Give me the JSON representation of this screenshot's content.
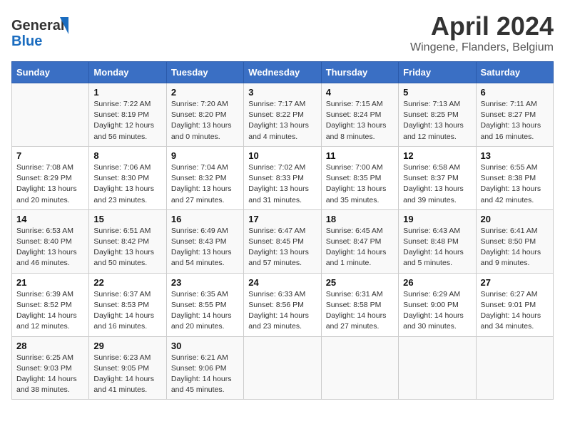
{
  "header": {
    "logo_line1": "General",
    "logo_line2": "Blue",
    "month_title": "April 2024",
    "location": "Wingene, Flanders, Belgium"
  },
  "days_of_week": [
    "Sunday",
    "Monday",
    "Tuesday",
    "Wednesday",
    "Thursday",
    "Friday",
    "Saturday"
  ],
  "weeks": [
    [
      {
        "num": "",
        "sunrise": "",
        "sunset": "",
        "daylight": ""
      },
      {
        "num": "1",
        "sunrise": "7:22 AM",
        "sunset": "8:19 PM",
        "daylight": "12 hours and 56 minutes."
      },
      {
        "num": "2",
        "sunrise": "7:20 AM",
        "sunset": "8:20 PM",
        "daylight": "13 hours and 0 minutes."
      },
      {
        "num": "3",
        "sunrise": "7:17 AM",
        "sunset": "8:22 PM",
        "daylight": "13 hours and 4 minutes."
      },
      {
        "num": "4",
        "sunrise": "7:15 AM",
        "sunset": "8:24 PM",
        "daylight": "13 hours and 8 minutes."
      },
      {
        "num": "5",
        "sunrise": "7:13 AM",
        "sunset": "8:25 PM",
        "daylight": "13 hours and 12 minutes."
      },
      {
        "num": "6",
        "sunrise": "7:11 AM",
        "sunset": "8:27 PM",
        "daylight": "13 hours and 16 minutes."
      }
    ],
    [
      {
        "num": "7",
        "sunrise": "7:08 AM",
        "sunset": "8:29 PM",
        "daylight": "13 hours and 20 minutes."
      },
      {
        "num": "8",
        "sunrise": "7:06 AM",
        "sunset": "8:30 PM",
        "daylight": "13 hours and 23 minutes."
      },
      {
        "num": "9",
        "sunrise": "7:04 AM",
        "sunset": "8:32 PM",
        "daylight": "13 hours and 27 minutes."
      },
      {
        "num": "10",
        "sunrise": "7:02 AM",
        "sunset": "8:33 PM",
        "daylight": "13 hours and 31 minutes."
      },
      {
        "num": "11",
        "sunrise": "7:00 AM",
        "sunset": "8:35 PM",
        "daylight": "13 hours and 35 minutes."
      },
      {
        "num": "12",
        "sunrise": "6:58 AM",
        "sunset": "8:37 PM",
        "daylight": "13 hours and 39 minutes."
      },
      {
        "num": "13",
        "sunrise": "6:55 AM",
        "sunset": "8:38 PM",
        "daylight": "13 hours and 42 minutes."
      }
    ],
    [
      {
        "num": "14",
        "sunrise": "6:53 AM",
        "sunset": "8:40 PM",
        "daylight": "13 hours and 46 minutes."
      },
      {
        "num": "15",
        "sunrise": "6:51 AM",
        "sunset": "8:42 PM",
        "daylight": "13 hours and 50 minutes."
      },
      {
        "num": "16",
        "sunrise": "6:49 AM",
        "sunset": "8:43 PM",
        "daylight": "13 hours and 54 minutes."
      },
      {
        "num": "17",
        "sunrise": "6:47 AM",
        "sunset": "8:45 PM",
        "daylight": "13 hours and 57 minutes."
      },
      {
        "num": "18",
        "sunrise": "6:45 AM",
        "sunset": "8:47 PM",
        "daylight": "14 hours and 1 minute."
      },
      {
        "num": "19",
        "sunrise": "6:43 AM",
        "sunset": "8:48 PM",
        "daylight": "14 hours and 5 minutes."
      },
      {
        "num": "20",
        "sunrise": "6:41 AM",
        "sunset": "8:50 PM",
        "daylight": "14 hours and 9 minutes."
      }
    ],
    [
      {
        "num": "21",
        "sunrise": "6:39 AM",
        "sunset": "8:52 PM",
        "daylight": "14 hours and 12 minutes."
      },
      {
        "num": "22",
        "sunrise": "6:37 AM",
        "sunset": "8:53 PM",
        "daylight": "14 hours and 16 minutes."
      },
      {
        "num": "23",
        "sunrise": "6:35 AM",
        "sunset": "8:55 PM",
        "daylight": "14 hours and 20 minutes."
      },
      {
        "num": "24",
        "sunrise": "6:33 AM",
        "sunset": "8:56 PM",
        "daylight": "14 hours and 23 minutes."
      },
      {
        "num": "25",
        "sunrise": "6:31 AM",
        "sunset": "8:58 PM",
        "daylight": "14 hours and 27 minutes."
      },
      {
        "num": "26",
        "sunrise": "6:29 AM",
        "sunset": "9:00 PM",
        "daylight": "14 hours and 30 minutes."
      },
      {
        "num": "27",
        "sunrise": "6:27 AM",
        "sunset": "9:01 PM",
        "daylight": "14 hours and 34 minutes."
      }
    ],
    [
      {
        "num": "28",
        "sunrise": "6:25 AM",
        "sunset": "9:03 PM",
        "daylight": "14 hours and 38 minutes."
      },
      {
        "num": "29",
        "sunrise": "6:23 AM",
        "sunset": "9:05 PM",
        "daylight": "14 hours and 41 minutes."
      },
      {
        "num": "30",
        "sunrise": "6:21 AM",
        "sunset": "9:06 PM",
        "daylight": "14 hours and 45 minutes."
      },
      {
        "num": "",
        "sunrise": "",
        "sunset": "",
        "daylight": ""
      },
      {
        "num": "",
        "sunrise": "",
        "sunset": "",
        "daylight": ""
      },
      {
        "num": "",
        "sunrise": "",
        "sunset": "",
        "daylight": ""
      },
      {
        "num": "",
        "sunrise": "",
        "sunset": "",
        "daylight": ""
      }
    ]
  ]
}
